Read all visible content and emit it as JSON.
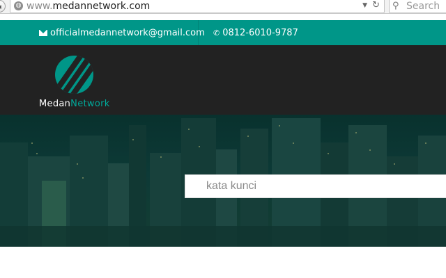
{
  "browser": {
    "url_prefix": "www.",
    "url_domain": "medannetwork.com",
    "search_placeholder": "Search",
    "icons": [
      "back-icon",
      "globe-icon",
      "dropdown-icon",
      "reload-icon",
      "magnifier-icon"
    ]
  },
  "topbar": {
    "email": "officialmedannetwork@gmail.com",
    "phone": "0812-6010-9787",
    "icons": [
      "envelope-icon",
      "phone-icon"
    ],
    "background": "#009688"
  },
  "header": {
    "logo_part1": "Medan",
    "logo_part2": "Network",
    "accent": "#00a99a",
    "background": "#222222"
  },
  "hero": {
    "search_placeholder": "kata kunci"
  }
}
